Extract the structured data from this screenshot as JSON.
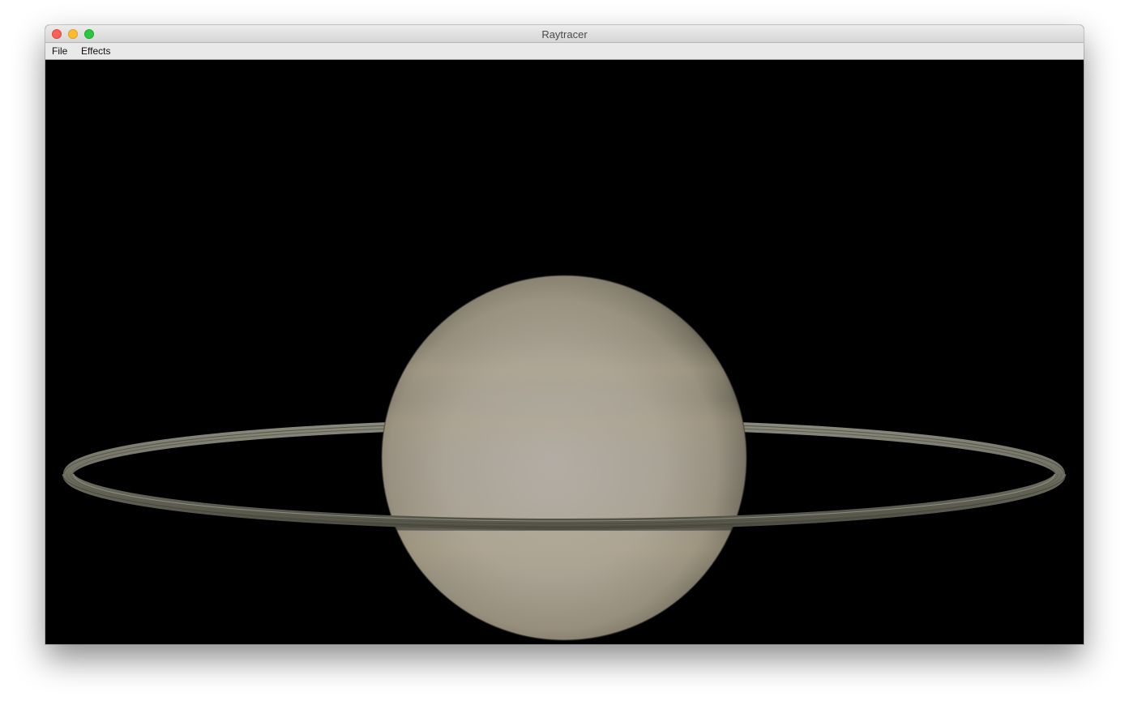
{
  "window": {
    "title": "Raytracer"
  },
  "traffic_lights": [
    "close-icon",
    "minimize-icon",
    "maximize-icon"
  ],
  "menu": {
    "items": [
      {
        "label": "File"
      },
      {
        "label": "Effects"
      }
    ]
  },
  "render": {
    "background": "#000000",
    "planet_color": "#b9b1a3",
    "ring_color": "#76766a"
  }
}
